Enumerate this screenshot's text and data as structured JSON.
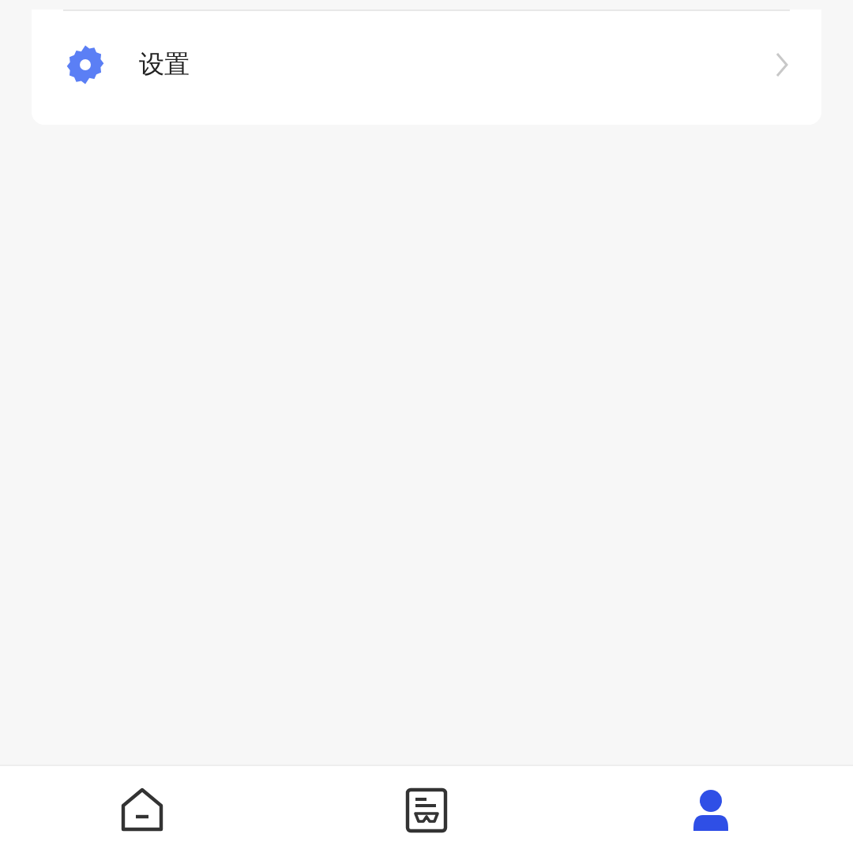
{
  "menu": {
    "items": [
      {
        "label": "设置"
      }
    ]
  },
  "tab_bar": {
    "tabs": [
      {
        "kind": "home",
        "selected": false
      },
      {
        "kind": "document",
        "selected": false
      },
      {
        "kind": "profile",
        "selected": true
      }
    ]
  }
}
